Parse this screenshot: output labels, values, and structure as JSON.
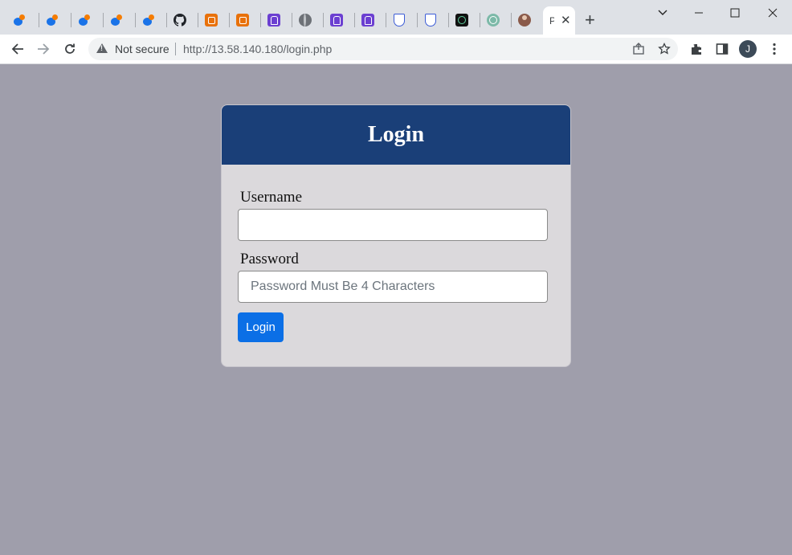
{
  "browser": {
    "tabs": [
      {
        "icon": "blue-app-icon"
      },
      {
        "icon": "blue-app-icon"
      },
      {
        "icon": "blue-app-icon"
      },
      {
        "icon": "blue-app-icon"
      },
      {
        "icon": "blue-app-icon"
      },
      {
        "icon": "github-icon"
      },
      {
        "icon": "orange-app-icon"
      },
      {
        "icon": "orange-app-icon"
      },
      {
        "icon": "purple-app-icon"
      },
      {
        "icon": "globe-icon"
      },
      {
        "icon": "purple-app-icon"
      },
      {
        "icon": "purple-app-icon"
      },
      {
        "icon": "shield-icon"
      },
      {
        "icon": "shield-icon"
      },
      {
        "icon": "dark-app-icon"
      },
      {
        "icon": "openai-icon"
      },
      {
        "icon": "profile-photo-icon"
      }
    ],
    "active_tab": {
      "title": "P",
      "close_glyph": "✕"
    },
    "new_tab_glyph": "+",
    "security_label": "Not secure",
    "url": "http://13.58.140.180/login.php",
    "profile_initial": "J"
  },
  "login_form": {
    "title": "Login",
    "username_label": "Username",
    "username_value": "",
    "password_label": "Password",
    "password_placeholder": "Password Must Be 4 Characters",
    "submit_label": "Login"
  },
  "colors": {
    "page_background": "#9f9eab",
    "header_background": "#1a3f78",
    "card_background": "#dbd9dc",
    "button_background": "#0b6fe6"
  }
}
